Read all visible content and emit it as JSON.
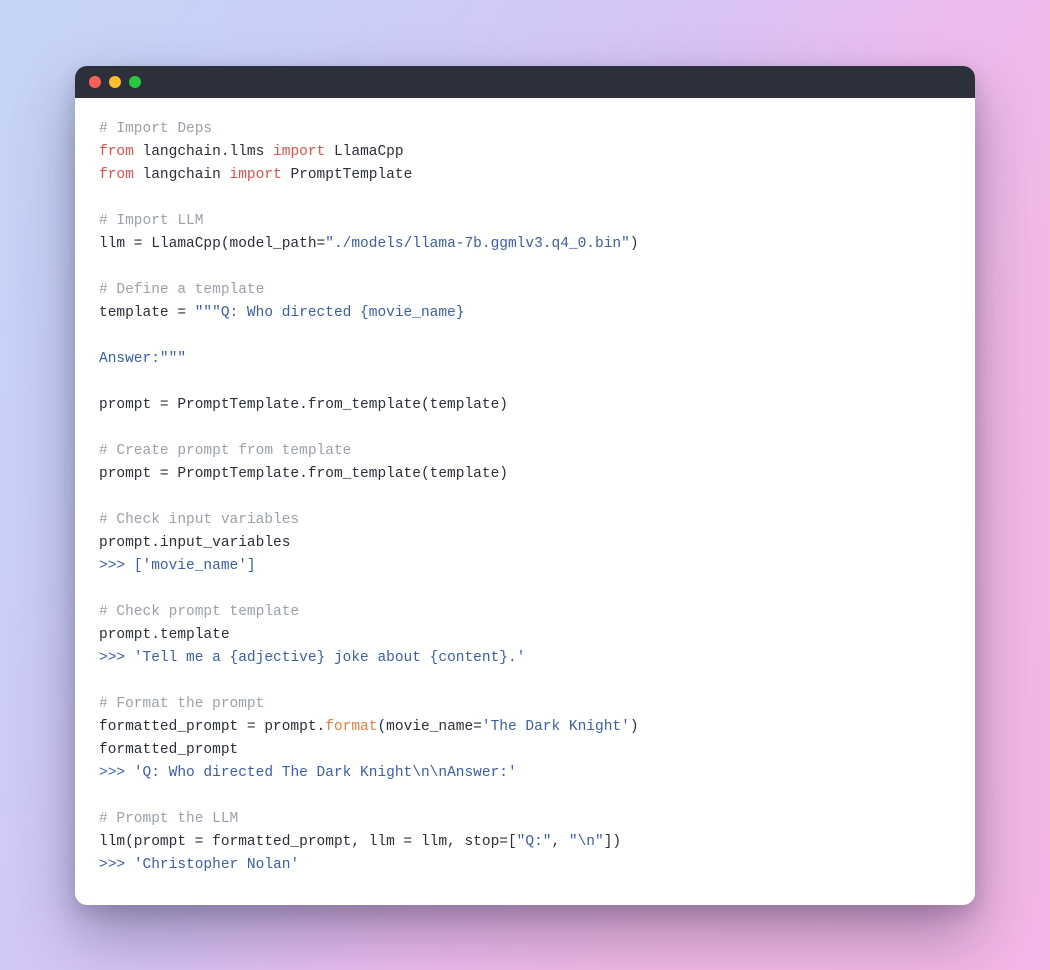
{
  "code": {
    "lines": [
      {
        "tokens": [
          {
            "cls": "c-comment",
            "text": "# Import Deps"
          }
        ]
      },
      {
        "tokens": [
          {
            "cls": "c-keyword",
            "text": "from"
          },
          {
            "cls": "",
            "text": " langchain.llms "
          },
          {
            "cls": "c-keyword",
            "text": "import"
          },
          {
            "cls": "",
            "text": " LlamaCpp"
          }
        ]
      },
      {
        "tokens": [
          {
            "cls": "c-keyword",
            "text": "from"
          },
          {
            "cls": "",
            "text": " langchain "
          },
          {
            "cls": "c-keyword",
            "text": "import"
          },
          {
            "cls": "",
            "text": " PromptTemplate"
          }
        ]
      },
      {
        "tokens": []
      },
      {
        "tokens": [
          {
            "cls": "c-comment",
            "text": "# Import LLM"
          }
        ]
      },
      {
        "tokens": [
          {
            "cls": "",
            "text": "llm = LlamaCpp(model_path="
          },
          {
            "cls": "c-string",
            "text": "\"./models/llama-7b.ggmlv3.q4_0.bin\""
          },
          {
            "cls": "",
            "text": ")"
          }
        ]
      },
      {
        "tokens": []
      },
      {
        "tokens": [
          {
            "cls": "c-comment",
            "text": "# Define a template"
          }
        ]
      },
      {
        "tokens": [
          {
            "cls": "",
            "text": "template = "
          },
          {
            "cls": "c-string",
            "text": "\"\"\"Q: Who directed {movie_name}"
          }
        ]
      },
      {
        "tokens": []
      },
      {
        "tokens": [
          {
            "cls": "c-string",
            "text": "Answer:\"\"\""
          }
        ]
      },
      {
        "tokens": []
      },
      {
        "tokens": [
          {
            "cls": "",
            "text": "prompt = PromptTemplate.from_template(template)"
          }
        ]
      },
      {
        "tokens": []
      },
      {
        "tokens": [
          {
            "cls": "c-comment",
            "text": "# Create prompt from template"
          }
        ]
      },
      {
        "tokens": [
          {
            "cls": "",
            "text": "prompt = PromptTemplate.from_template(template)"
          }
        ]
      },
      {
        "tokens": []
      },
      {
        "tokens": [
          {
            "cls": "c-comment",
            "text": "# Check input variables"
          }
        ]
      },
      {
        "tokens": [
          {
            "cls": "",
            "text": "prompt.input_variables"
          }
        ]
      },
      {
        "tokens": [
          {
            "cls": "c-output",
            "text": ">>> "
          },
          {
            "cls": "c-output",
            "text": "['movie_name']"
          }
        ]
      },
      {
        "tokens": []
      },
      {
        "tokens": [
          {
            "cls": "c-comment",
            "text": "# Check prompt template"
          }
        ]
      },
      {
        "tokens": [
          {
            "cls": "",
            "text": "prompt.template"
          }
        ]
      },
      {
        "tokens": [
          {
            "cls": "c-output",
            "text": ">>> "
          },
          {
            "cls": "c-output",
            "text": "'Tell me a {adjective} joke about {content}.'"
          }
        ]
      },
      {
        "tokens": []
      },
      {
        "tokens": [
          {
            "cls": "c-comment",
            "text": "# Format the prompt"
          }
        ]
      },
      {
        "tokens": [
          {
            "cls": "",
            "text": "formatted_prompt = prompt."
          },
          {
            "cls": "c-call",
            "text": "format"
          },
          {
            "cls": "",
            "text": "(movie_name="
          },
          {
            "cls": "c-string",
            "text": "'The Dark Knight'"
          },
          {
            "cls": "",
            "text": ")"
          }
        ]
      },
      {
        "tokens": [
          {
            "cls": "",
            "text": "formatted_prompt"
          }
        ]
      },
      {
        "tokens": [
          {
            "cls": "c-output",
            "text": ">>> "
          },
          {
            "cls": "c-output",
            "text": "'Q: Who directed The Dark Knight\\n\\nAnswer:'"
          }
        ]
      },
      {
        "tokens": []
      },
      {
        "tokens": [
          {
            "cls": "c-comment",
            "text": "# Prompt the LLM"
          }
        ]
      },
      {
        "tokens": [
          {
            "cls": "",
            "text": "llm(prompt = formatted_prompt, llm = llm, stop=["
          },
          {
            "cls": "c-string",
            "text": "\"Q:\""
          },
          {
            "cls": "",
            "text": ", "
          },
          {
            "cls": "c-string",
            "text": "\"\\n\""
          },
          {
            "cls": "",
            "text": "])"
          }
        ]
      },
      {
        "tokens": [
          {
            "cls": "c-output",
            "text": ">>> "
          },
          {
            "cls": "c-output",
            "text": "'Christopher Nolan'"
          }
        ]
      }
    ]
  }
}
